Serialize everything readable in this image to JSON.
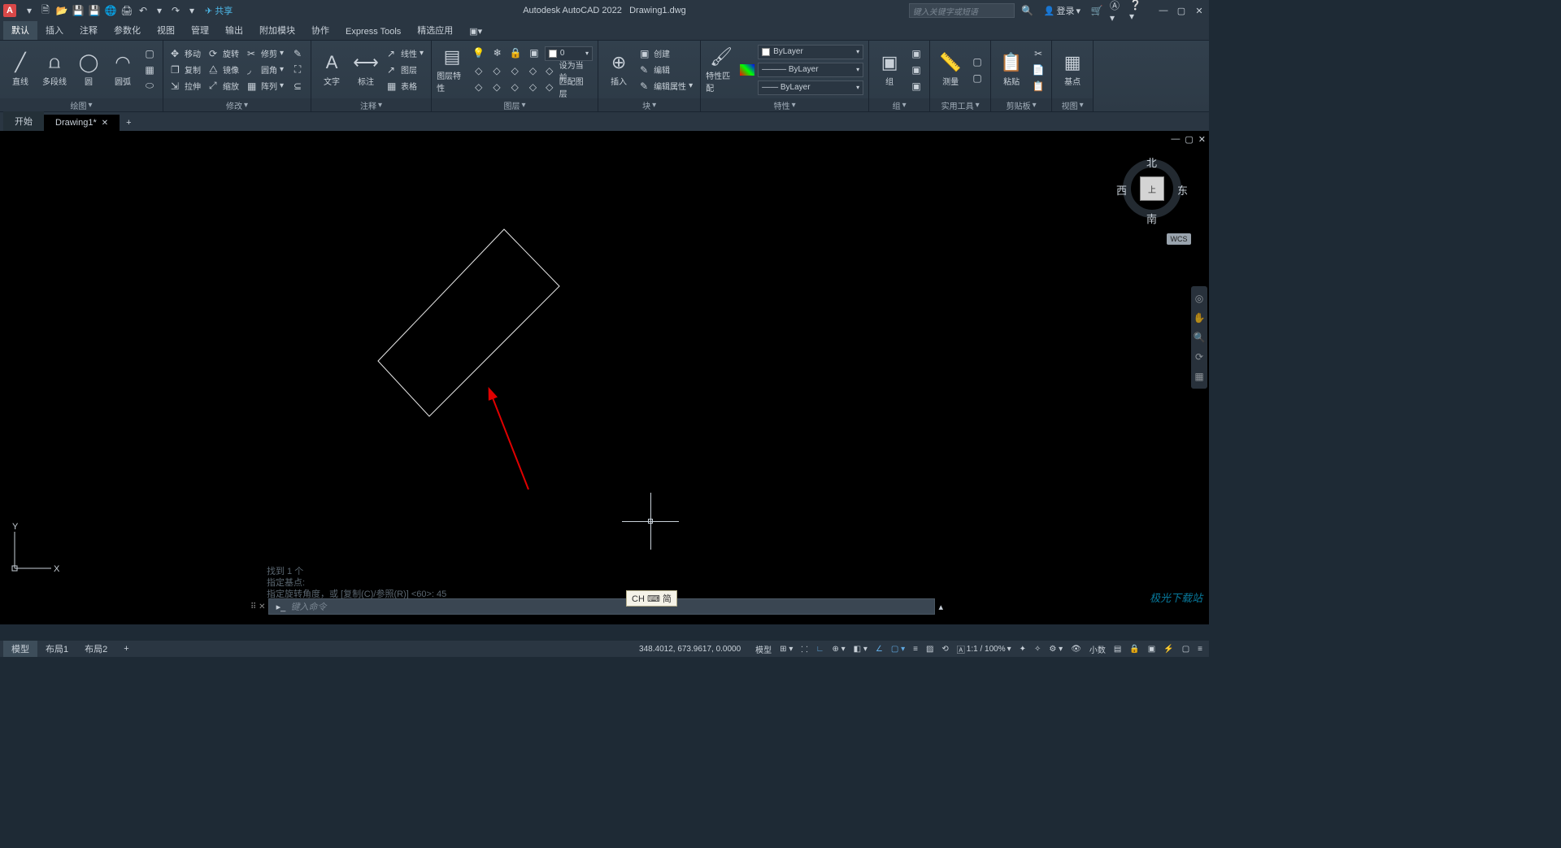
{
  "title": {
    "app": "Autodesk AutoCAD 2022",
    "file": "Drawing1.dwg"
  },
  "qat_share": "共享",
  "search_placeholder": "键入关键字或短语",
  "login": "登录",
  "menu": [
    "默认",
    "插入",
    "注释",
    "参数化",
    "视图",
    "管理",
    "输出",
    "附加模块",
    "协作",
    "Express Tools",
    "精选应用"
  ],
  "menu_active": 0,
  "ribbon": {
    "draw": {
      "title": "绘图",
      "line": "直线",
      "pline": "多段线",
      "circle": "圆",
      "arc": "圆弧"
    },
    "modify": {
      "title": "修改",
      "move": "移动",
      "rotate": "旋转",
      "trim": "修剪",
      "copy": "复制",
      "mirror": "镜像",
      "fillet": "圆角",
      "stretch": "拉伸",
      "scale": "缩放",
      "array": "阵列"
    },
    "annot": {
      "title": "注释",
      "text": "文字",
      "dim": "标注",
      "table": "表格"
    },
    "layer": {
      "title": "图层",
      "props": "图层特性",
      "layers": [
        "线性",
        "图层",
        "图层",
        "设为当前",
        "匹配图层"
      ],
      "current": "0"
    },
    "block": {
      "title": "块",
      "insert": "插入",
      "create": "创建",
      "edit": "编辑",
      "editattr": "编辑属性"
    },
    "props": {
      "title": "特性",
      "match": "特性匹配",
      "bylayer": "ByLayer"
    },
    "group": {
      "title": "组",
      "group": "组"
    },
    "util": {
      "title": "实用工具",
      "measure": "测量"
    },
    "clip": {
      "title": "剪贴板",
      "paste": "粘贴"
    },
    "view": {
      "title": "视图",
      "base": "基点"
    }
  },
  "file_tabs": {
    "start": "开始",
    "drawing": "Drawing1*"
  },
  "viewcube": {
    "n": "北",
    "s": "南",
    "e": "东",
    "w": "西",
    "top": "上",
    "wcs": "WCS"
  },
  "cmd_history": [
    "找到 1 个",
    "指定基点:",
    "指定旋转角度，或 [复制(C)/参照(R)] <60>: 45"
  ],
  "cmd_prompt": "键入命令",
  "ucs": {
    "x": "X",
    "y": "Y"
  },
  "model_tabs": [
    "模型",
    "布局1",
    "布局2",
    "+"
  ],
  "status": {
    "coords": "348.4012, 673.9617, 0.0000",
    "model": "模型",
    "scale": "1:1 / 100%",
    "decimal": "小数"
  },
  "ime": "CH ⌨ 简",
  "watermark": "极光下载站"
}
